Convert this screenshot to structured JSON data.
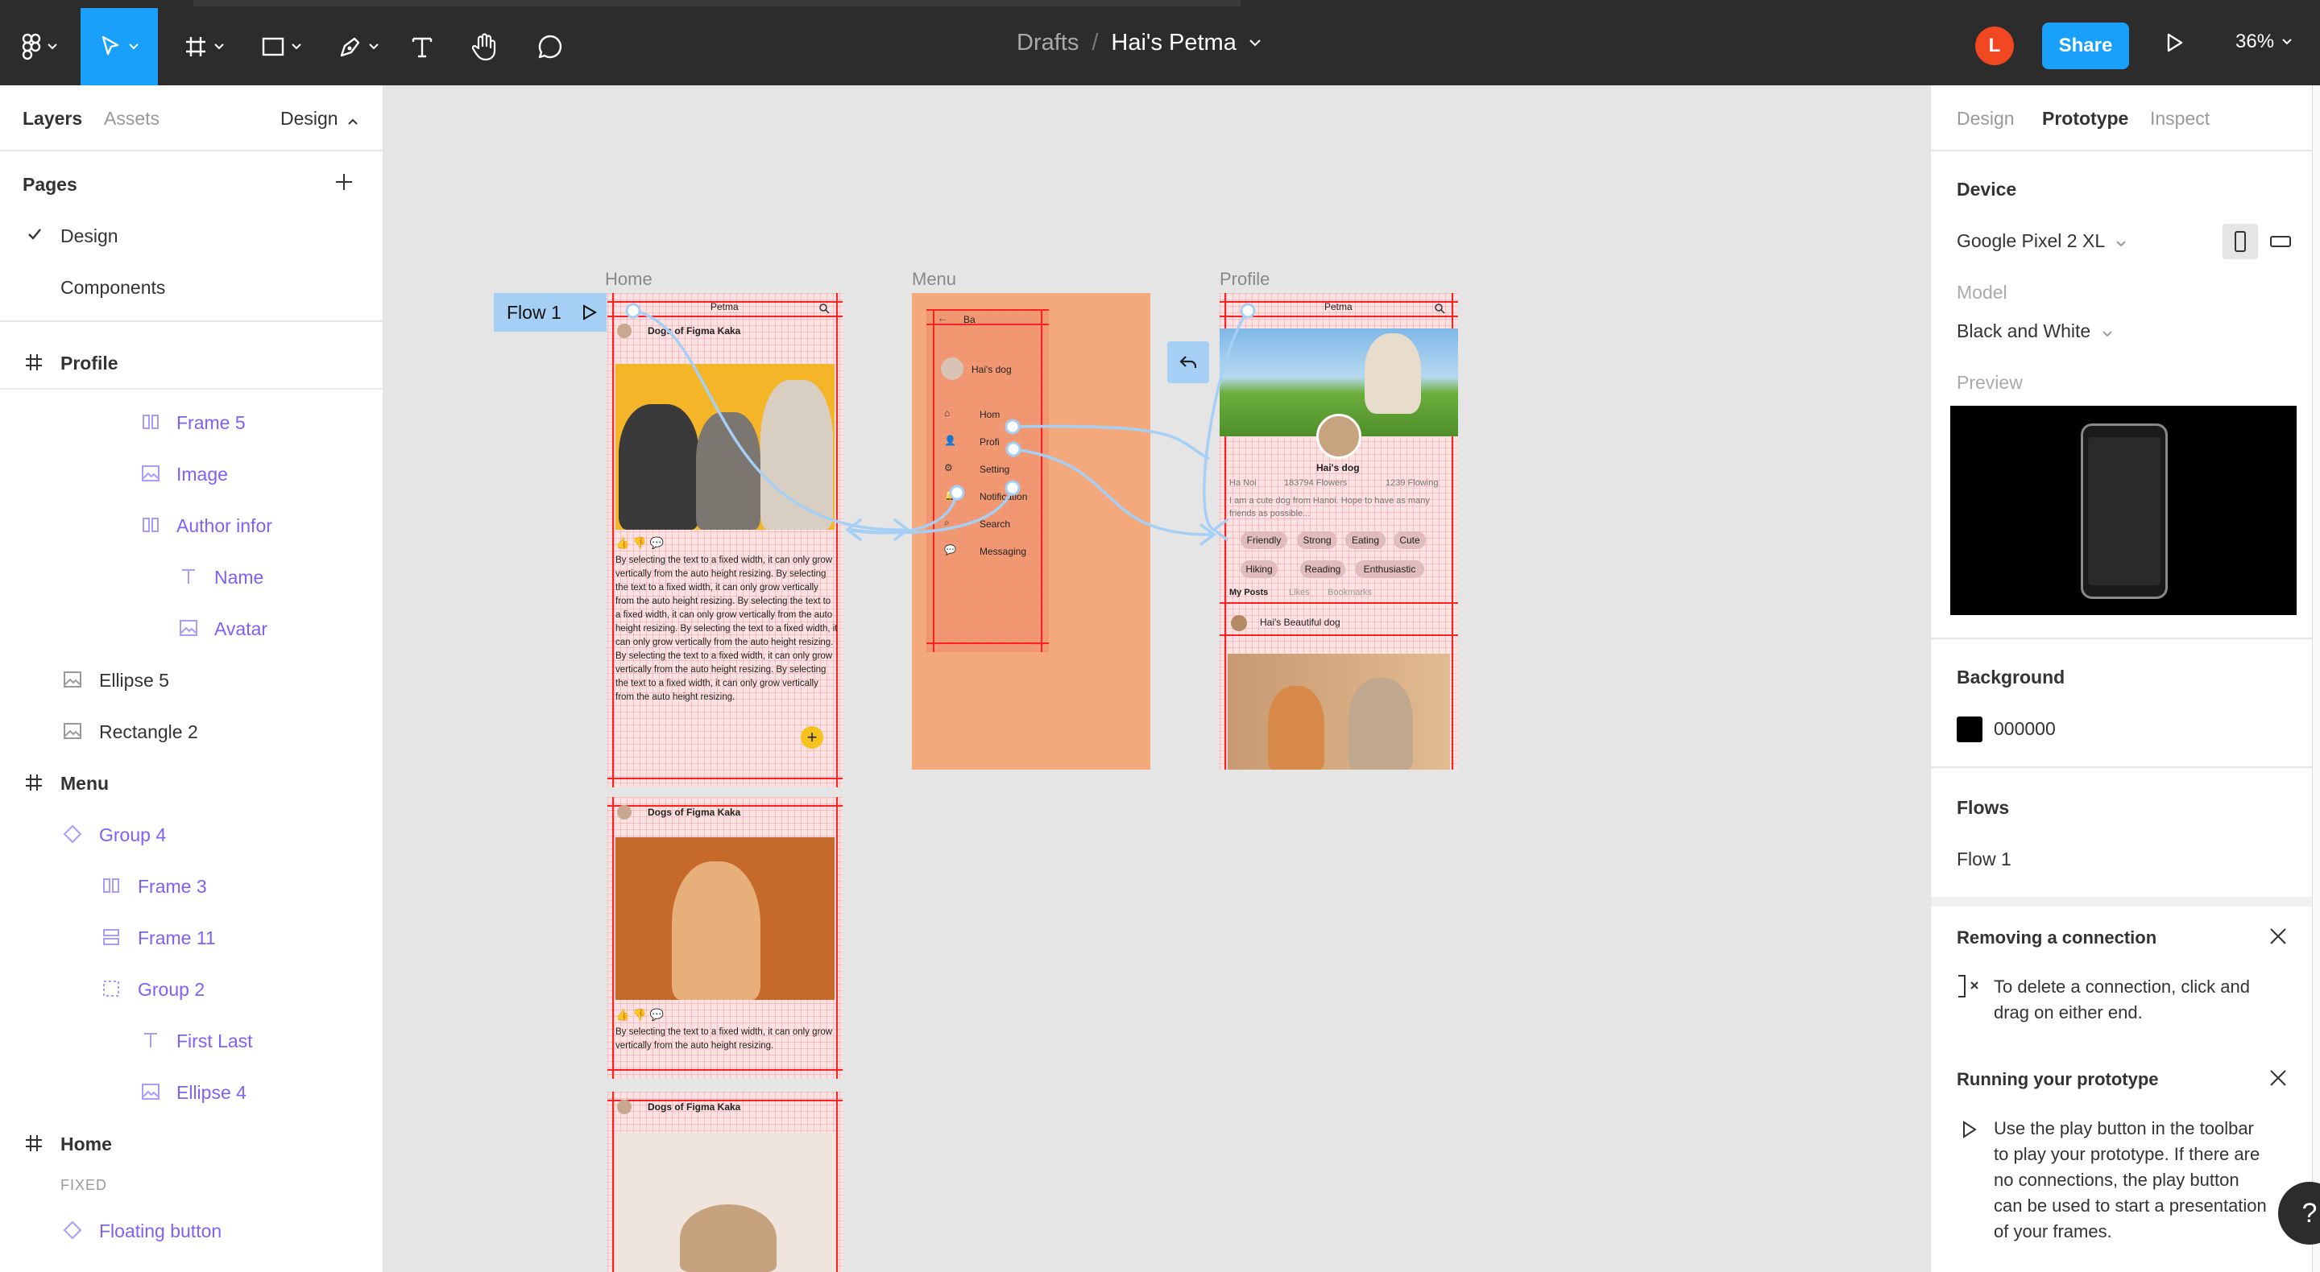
{
  "toolbar": {
    "breadcrumb_parent": "Drafts",
    "breadcrumb_sep": "/",
    "file_name": "Hai's Petma",
    "avatar_initial": "L",
    "share_label": "Share",
    "zoom": "36%"
  },
  "left": {
    "tabs": {
      "layers": "Layers",
      "assets": "Assets",
      "design": "Design"
    },
    "pages_title": "Pages",
    "pages": [
      "Design",
      "Components"
    ],
    "layers": [
      {
        "label": "Profile"
      },
      {
        "label": "Frame 5"
      },
      {
        "label": "Image"
      },
      {
        "label": "Author infor"
      },
      {
        "label": "Name"
      },
      {
        "label": "Avatar"
      },
      {
        "label": "Ellipse 5"
      },
      {
        "label": "Rectangle 2"
      },
      {
        "label": "Menu"
      },
      {
        "label": "Group 4"
      },
      {
        "label": "Frame 3"
      },
      {
        "label": "Frame 11"
      },
      {
        "label": "Group 2"
      },
      {
        "label": "First Last"
      },
      {
        "label": "Ellipse 4"
      },
      {
        "label": "Home"
      },
      {
        "label": "Floating button"
      }
    ],
    "fixed_label": "FIXED"
  },
  "right": {
    "tabs": {
      "design": "Design",
      "prototype": "Prototype",
      "inspect": "Inspect"
    },
    "device_title": "Device",
    "device_value": "Google Pixel 2 XL",
    "model_label": "Model",
    "model_value": "Black and White",
    "preview_label": "Preview",
    "background_title": "Background",
    "background_value": "000000",
    "flows_title": "Flows",
    "flow_name": "Flow 1",
    "tip1_title": "Removing a connection",
    "tip1_text": "To delete a connection, click and drag on either end.",
    "tip2_title": "Running your prototype",
    "tip2_text": "Use the play button in the toolbar to play your prototype. If there are no connections, the play button can be used to start a presentation of your frames."
  },
  "help_label": "?",
  "canvas": {
    "flow_tag": "Flow 1",
    "frames": {
      "home": "Home",
      "menu": "Menu",
      "profile": "Profile"
    },
    "home": {
      "app_title": "Petma",
      "post_author": "Dogs of Figma Kaka",
      "post_text": "By selecting the text to a fixed width, it can only grow vertically from the auto height resizing. By selecting the text to a fixed width, it can only grow vertically from the auto height resizing. By selecting the text to a fixed width, it can only grow vertically from the auto height resizing. By selecting the text to a fixed width, it can only grow vertically from the auto height resizing. By selecting the text to a fixed width, it can only grow vertically from the auto height resizing. By selecting the text to a fixed width, it can only grow vertically from the auto height resizing.",
      "post2_author": "Dogs of Figma Kaka",
      "post2_text": "By selecting the text to a fixed width, it can only grow vertically from the auto height resizing.",
      "post3_author": "Dogs of Figma Kaka"
    },
    "menu": {
      "back": "Ba",
      "user": "Hai's dog",
      "items": [
        "Hom",
        "Profi",
        "Setting",
        "Notification",
        "Search",
        "Messaging"
      ]
    },
    "profile": {
      "app_title": "Petma",
      "name": "Hai's dog",
      "location": "Ha Noi",
      "followers": "183794 Flowers",
      "following": "1239 Flowing",
      "bio": "I am a cute dog from Hanoi. Hope to have as many friends as possible...",
      "tags": [
        "Friendly",
        "Strong",
        "Eating",
        "Cute",
        "Hiking",
        "Reading",
        "Enthusiastic"
      ],
      "tabs": [
        "My Posts",
        "Likes",
        "Bookmarks"
      ],
      "post_author": "Hai's Beautiful dog"
    }
  },
  "colors": {
    "accent": "#18a0fb",
    "toolbar_bg": "#2c2c2c",
    "layer_purple": "#7b61ff",
    "menu_frame": "#f4a97c",
    "flow_tag": "#a5cff5"
  }
}
